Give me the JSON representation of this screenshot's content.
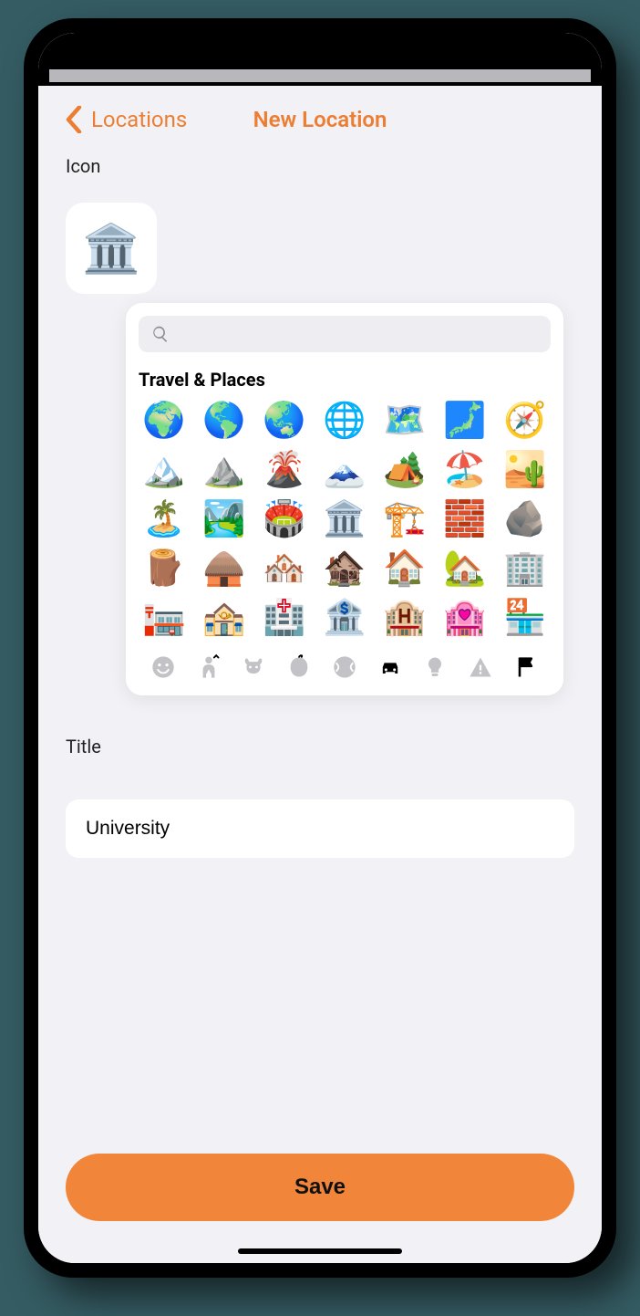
{
  "nav": {
    "back_label": "Locations",
    "title": "New Location"
  },
  "icon_section": {
    "label": "Icon",
    "selected_emoji": "🏛️"
  },
  "emoji_picker": {
    "search_placeholder": "",
    "category_label": "Travel & Places",
    "emojis": [
      "🌍",
      "🌎",
      "🌏",
      "🌐",
      "🗺️",
      "🗾",
      "🧭",
      "🏔️",
      "⛰️",
      "🌋",
      "🗻",
      "🏕️",
      "🏖️",
      "🏜️",
      "🏝️",
      "🏞️",
      "🏟️",
      "🏛️",
      "🏗️",
      "🧱",
      "🪨",
      "🪵",
      "🛖",
      "🏘️",
      "🏚️",
      "🏠",
      "🏡",
      "🏢",
      "🏣",
      "🏤",
      "🏥",
      "🏦",
      "🏨",
      "🏩",
      "🏪"
    ],
    "tabs": [
      {
        "name": "smileys",
        "active": false
      },
      {
        "name": "people",
        "active": false
      },
      {
        "name": "animals",
        "active": false
      },
      {
        "name": "food",
        "active": false
      },
      {
        "name": "activity",
        "active": false
      },
      {
        "name": "travel",
        "active": true
      },
      {
        "name": "objects",
        "active": false
      },
      {
        "name": "symbols",
        "active": false
      },
      {
        "name": "flags",
        "active": false
      }
    ]
  },
  "title_section": {
    "label": "Title",
    "value": "University"
  },
  "save_button": {
    "label": "Save"
  },
  "colors": {
    "accent": "#ec7e33",
    "save_bg": "#f1863a",
    "page_bg": "#f2f1f6"
  }
}
